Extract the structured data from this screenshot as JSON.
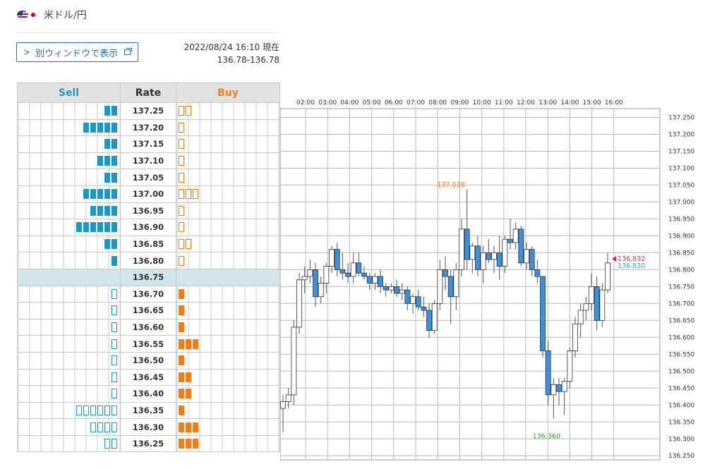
{
  "header": {
    "pair": "米ドル/円"
  },
  "window_button": {
    "label": "別ウィンドウで表示"
  },
  "quote": {
    "timestamp": "2022/08/24 16:10 現在",
    "bidask": "136.78-136.78"
  },
  "book": {
    "headers": {
      "sell": "Sell",
      "rate": "Rate",
      "buy": "Buy"
    },
    "current_rate": "136.75",
    "rows": [
      {
        "rate": "137.25",
        "sell": 2,
        "sell_style": "filled",
        "buy": 2,
        "buy_style": "outline"
      },
      {
        "rate": "137.20",
        "sell": 5,
        "sell_style": "filled",
        "buy": 1,
        "buy_style": "outline"
      },
      {
        "rate": "137.15",
        "sell": 2,
        "sell_style": "filled",
        "buy": 1,
        "buy_style": "outline"
      },
      {
        "rate": "137.10",
        "sell": 3,
        "sell_style": "filled",
        "buy": 1,
        "buy_style": "outline"
      },
      {
        "rate": "137.05",
        "sell": 2,
        "sell_style": "filled",
        "buy": 1,
        "buy_style": "outline"
      },
      {
        "rate": "137.00",
        "sell": 5,
        "sell_style": "filled",
        "buy": 3,
        "buy_style": "outline"
      },
      {
        "rate": "136.95",
        "sell": 4,
        "sell_style": "filled",
        "buy": 1,
        "buy_style": "outline"
      },
      {
        "rate": "136.90",
        "sell": 6,
        "sell_style": "filled",
        "buy": 1,
        "buy_style": "outline"
      },
      {
        "rate": "136.85",
        "sell": 2,
        "sell_style": "filled",
        "buy": 2,
        "buy_style": "outline"
      },
      {
        "rate": "136.80",
        "sell": 1,
        "sell_style": "filled",
        "buy": 1,
        "buy_style": "outline"
      },
      {
        "rate": "136.75",
        "sell": 0,
        "sell_style": "filled",
        "buy": 0,
        "buy_style": "filled"
      },
      {
        "rate": "136.70",
        "sell": 1,
        "sell_style": "outline",
        "buy": 1,
        "buy_style": "filled"
      },
      {
        "rate": "136.65",
        "sell": 1,
        "sell_style": "outline",
        "buy": 1,
        "buy_style": "filled"
      },
      {
        "rate": "136.60",
        "sell": 1,
        "sell_style": "outline",
        "buy": 1,
        "buy_style": "filled"
      },
      {
        "rate": "136.55",
        "sell": 1,
        "sell_style": "outline",
        "buy": 3,
        "buy_style": "filled"
      },
      {
        "rate": "136.50",
        "sell": 1,
        "sell_style": "outline",
        "buy": 1,
        "buy_style": "filled"
      },
      {
        "rate": "136.45",
        "sell": 1,
        "sell_style": "outline",
        "buy": 2,
        "buy_style": "filled"
      },
      {
        "rate": "136.40",
        "sell": 1,
        "sell_style": "outline",
        "buy": 2,
        "buy_style": "filled"
      },
      {
        "rate": "136.35",
        "sell": 6,
        "sell_style": "outline",
        "buy": 1,
        "buy_style": "filled"
      },
      {
        "rate": "136.30",
        "sell": 4,
        "sell_style": "outline",
        "buy": 3,
        "buy_style": "filled"
      },
      {
        "rate": "136.25",
        "sell": 2,
        "sell_style": "outline",
        "buy": 3,
        "buy_style": "filled"
      }
    ]
  },
  "colors": {
    "up": "#ffffff",
    "down": "#3d8fe0",
    "wick": "#555555",
    "high_label": "#f07c24",
    "low_label": "#22aa22",
    "ask_label": "#e0245e",
    "bid_label": "#1ab0d8"
  },
  "chart_data": {
    "type": "candlestick",
    "x_ticks": [
      "02:00",
      "03:00",
      "04:00",
      "05:00",
      "06:00",
      "07:00",
      "08:00",
      "09:00",
      "10:00",
      "11:00",
      "12:00",
      "13:00",
      "14:00",
      "15:00",
      "16:00"
    ],
    "y_ticks": [
      "137.250",
      "137.200",
      "137.150",
      "137.100",
      "137.050",
      "137.000",
      "136.950",
      "136.900",
      "136.850",
      "136.800",
      "136.750",
      "136.700",
      "136.650",
      "136.600",
      "136.550",
      "136.500",
      "136.450",
      "136.400",
      "136.350",
      "136.300",
      "136.250"
    ],
    "ylim": [
      136.238,
      137.276
    ],
    "grid": true,
    "annotations": {
      "high": "137.038",
      "low": "136.360",
      "ask": "136.832",
      "bid": "136.830"
    },
    "candles": [
      [
        136.39,
        136.43,
        136.32,
        136.41
      ],
      [
        136.41,
        136.45,
        136.39,
        136.43
      ],
      [
        136.43,
        136.65,
        136.4,
        136.63
      ],
      [
        136.63,
        136.79,
        136.61,
        136.77
      ],
      [
        136.77,
        136.81,
        136.73,
        136.78
      ],
      [
        136.78,
        136.83,
        136.76,
        136.8
      ],
      [
        136.8,
        136.82,
        136.69,
        136.72
      ],
      [
        136.72,
        136.78,
        136.7,
        136.76
      ],
      [
        136.76,
        136.82,
        136.73,
        136.81
      ],
      [
        136.81,
        136.87,
        136.79,
        136.86
      ],
      [
        136.86,
        136.88,
        136.78,
        136.8
      ],
      [
        136.8,
        136.85,
        136.77,
        136.79
      ],
      [
        136.79,
        136.82,
        136.76,
        136.78
      ],
      [
        136.78,
        136.85,
        136.76,
        136.82
      ],
      [
        136.82,
        136.85,
        136.78,
        136.79
      ],
      [
        136.79,
        136.81,
        136.77,
        136.78
      ],
      [
        136.78,
        136.79,
        136.74,
        136.76
      ],
      [
        136.76,
        136.79,
        136.74,
        136.78
      ],
      [
        136.78,
        136.8,
        136.73,
        136.75
      ],
      [
        136.75,
        136.76,
        136.72,
        136.74
      ],
      [
        136.74,
        136.76,
        136.73,
        136.75
      ],
      [
        136.75,
        136.77,
        136.72,
        136.73
      ],
      [
        136.73,
        136.76,
        136.71,
        136.74
      ],
      [
        136.74,
        136.75,
        136.68,
        136.7
      ],
      [
        136.7,
        136.73,
        136.67,
        136.72
      ],
      [
        136.72,
        136.74,
        136.68,
        136.69
      ],
      [
        136.69,
        136.72,
        136.66,
        136.68
      ],
      [
        136.68,
        136.7,
        136.6,
        136.62
      ],
      [
        136.62,
        136.71,
        136.61,
        136.7
      ],
      [
        136.7,
        136.83,
        136.68,
        136.8
      ],
      [
        136.8,
        136.84,
        136.74,
        136.78
      ],
      [
        136.78,
        136.8,
        136.64,
        136.72
      ],
      [
        136.72,
        136.82,
        136.68,
        136.8
      ],
      [
        136.8,
        136.95,
        136.78,
        136.92
      ],
      [
        136.92,
        137.038,
        136.8,
        136.83
      ],
      [
        136.83,
        136.88,
        136.79,
        136.87
      ],
      [
        136.87,
        136.9,
        136.78,
        136.8
      ],
      [
        136.8,
        136.87,
        136.76,
        136.85
      ],
      [
        136.85,
        136.89,
        136.82,
        136.83
      ],
      [
        136.83,
        136.87,
        136.79,
        136.85
      ],
      [
        136.85,
        136.9,
        136.77,
        136.81
      ],
      [
        136.81,
        136.9,
        136.79,
        136.89
      ],
      [
        136.89,
        136.95,
        136.86,
        136.88
      ],
      [
        136.88,
        136.94,
        136.86,
        136.92
      ],
      [
        136.92,
        136.93,
        136.81,
        136.82
      ],
      [
        136.82,
        136.88,
        136.8,
        136.86
      ],
      [
        136.86,
        136.87,
        136.78,
        136.8
      ],
      [
        136.8,
        136.83,
        136.76,
        136.78
      ],
      [
        136.78,
        136.76,
        136.54,
        136.56
      ],
      [
        136.56,
        136.59,
        136.4,
        136.43
      ],
      [
        136.43,
        136.48,
        136.36,
        136.46
      ],
      [
        136.46,
        136.48,
        136.4,
        136.44
      ],
      [
        136.44,
        136.48,
        136.37,
        136.47
      ],
      [
        136.47,
        136.57,
        136.45,
        136.56
      ],
      [
        136.56,
        136.66,
        136.54,
        136.64
      ],
      [
        136.64,
        136.7,
        136.6,
        136.68
      ],
      [
        136.68,
        136.72,
        136.65,
        136.7
      ],
      [
        136.7,
        136.79,
        136.68,
        136.75
      ],
      [
        136.75,
        136.78,
        136.62,
        136.65
      ],
      [
        136.65,
        136.76,
        136.63,
        136.74
      ],
      [
        136.74,
        136.85,
        136.73,
        136.82
      ]
    ]
  }
}
